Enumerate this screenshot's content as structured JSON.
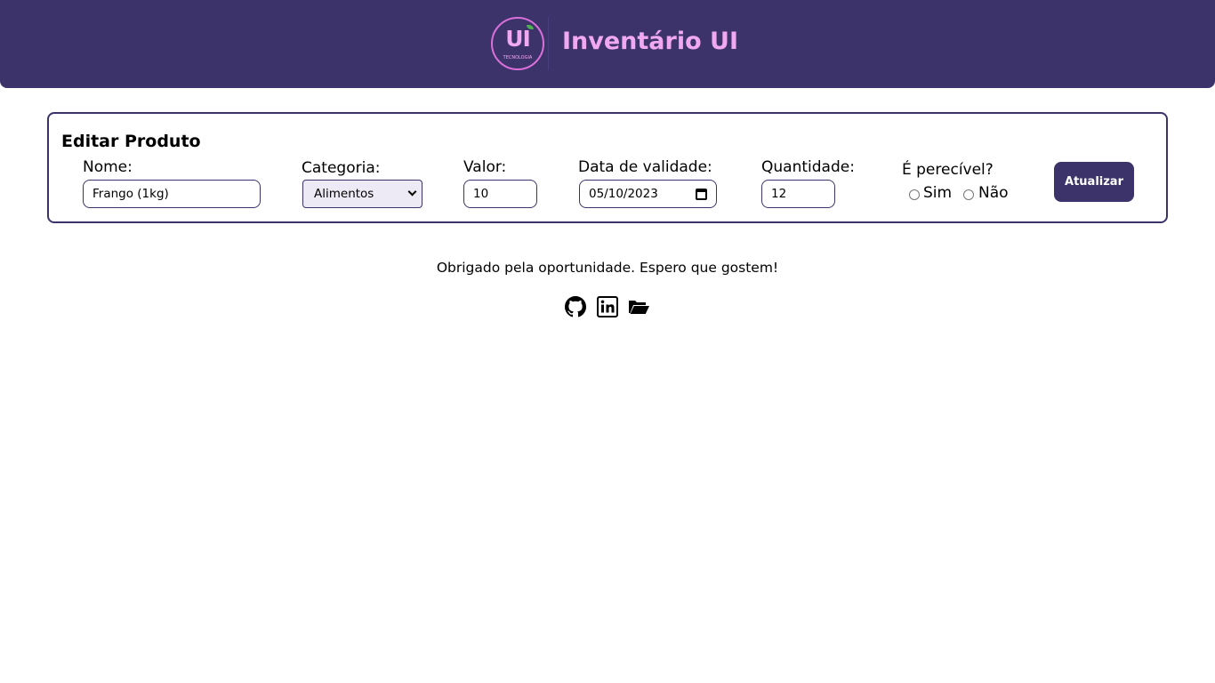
{
  "header": {
    "logo_text": "UI",
    "logo_subtext": "TECNOLOGIA",
    "app_title": "Inventário UI"
  },
  "form": {
    "title": "Editar Produto",
    "name": {
      "label": "Nome:",
      "value": "Frango (1kg)"
    },
    "category": {
      "label": "Categoria:",
      "selected": "Alimentos"
    },
    "price": {
      "label": "Valor:",
      "value": "10"
    },
    "expiry": {
      "label": "Data de validade:",
      "value": "05/10/2023"
    },
    "quantity": {
      "label": "Quantidade:",
      "value": "12"
    },
    "perishable": {
      "label": "É perecível?",
      "options": [
        "Sim",
        "Não"
      ]
    },
    "update_label": "Atualizar"
  },
  "footer": {
    "message": "Obrigado pela oportunidade. Espero que gostem!",
    "links": [
      "github-icon",
      "linkedin-icon",
      "folder-open-icon"
    ]
  },
  "colors": {
    "primary": "#3d336b",
    "accent": "#f0a8f0"
  }
}
